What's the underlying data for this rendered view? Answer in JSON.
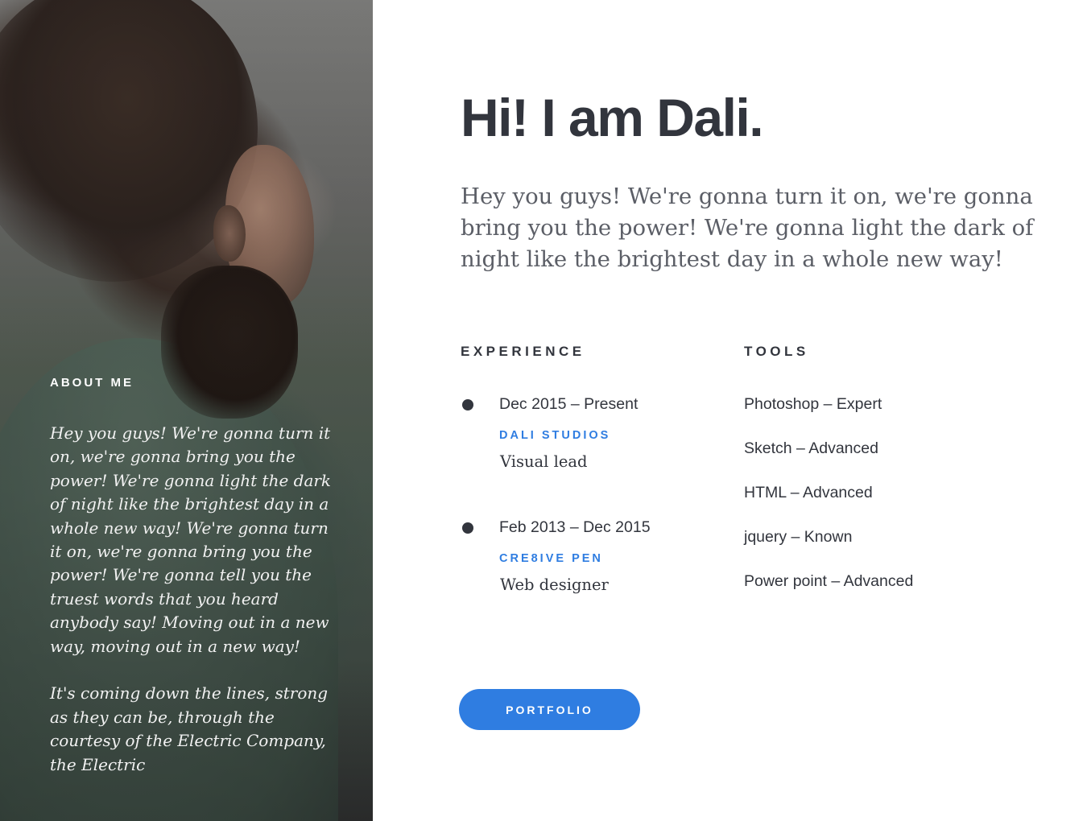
{
  "about": {
    "title": "ABOUT ME",
    "paragraphs": [
      "Hey you guys! We're gonna turn it on, we're gonna bring you the power! We're gonna light the dark of night like the brightest day in a whole new way! We're gonna turn it on, we're gonna bring you the power! We're gonna tell you the truest words that you heard anybody say! Moving out in a new way, moving out in a new way!",
      "It's coming down the lines, strong as they can be, through the courtesy of the Electric Company, the Electric"
    ]
  },
  "hero": {
    "headline": "Hi! I am Dali.",
    "intro": "Hey you guys! We're gonna turn it on, we're gonna bring you the power! We're gonna light the dark of night like the brightest day in a whole new way!"
  },
  "experience": {
    "heading": "EXPERIENCE",
    "items": [
      {
        "dates": "Dec 2015 – Present",
        "company": "DALI STUDIOS",
        "role": "Visual lead"
      },
      {
        "dates": "Feb 2013 – Dec 2015",
        "company": "CRE8IVE PEN",
        "role": "Web designer"
      }
    ]
  },
  "tools": {
    "heading": "TOOLS",
    "items": [
      "Photoshop – Expert",
      "Sketch – Advanced",
      "HTML – Advanced",
      "jquery – Known",
      "Power point – Advanced"
    ]
  },
  "portfolio_button": {
    "label": "PORTFOLIO"
  },
  "colors": {
    "accent": "#2f7de1",
    "text_dark": "#32353d",
    "text_muted": "#5b5e66"
  }
}
